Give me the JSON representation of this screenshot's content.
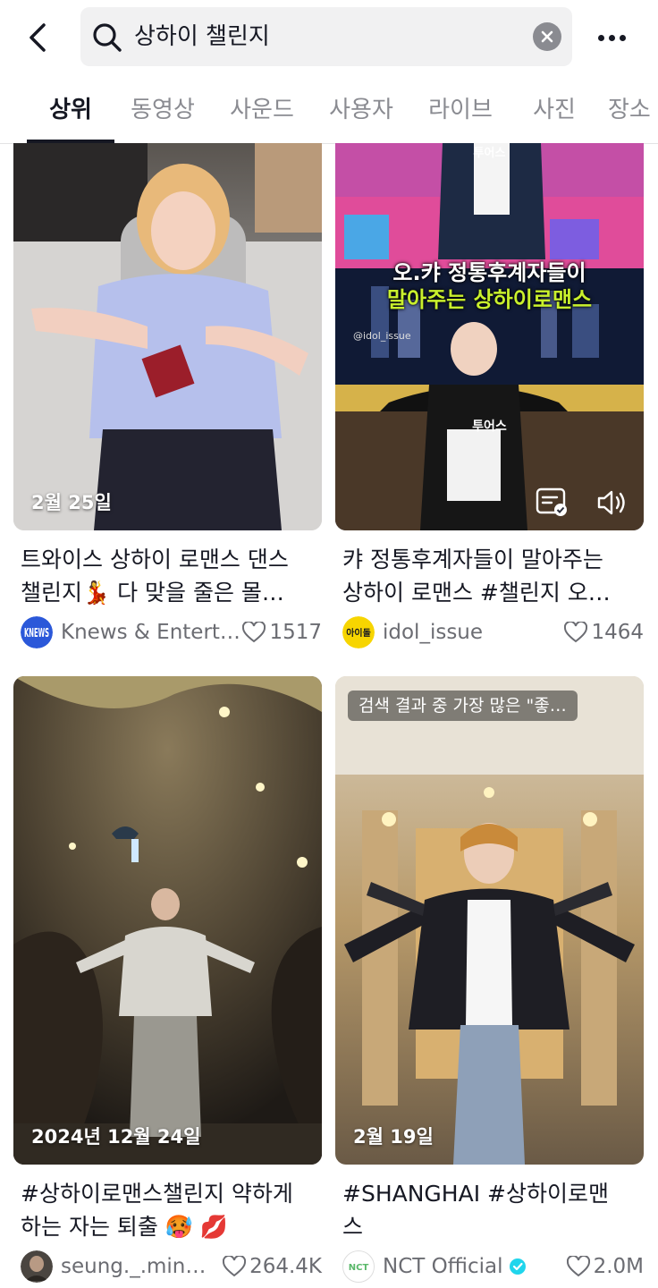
{
  "search": {
    "query": "상하이 챌린지"
  },
  "tabs": [
    "상위",
    "동영상",
    "사운드",
    "사용자",
    "라이브",
    "사진",
    "장소"
  ],
  "videos": [
    {
      "date": "2월 25일",
      "title_line1": "트와이스 상하이 로맨스 댄스",
      "title_line2": "챌린지💃 다 맞을 줄은 몰…",
      "author": "Knews & Entert…",
      "likes": "1517",
      "avatar_text": "KNEWS"
    },
    {
      "date": "",
      "title_line1": "캬 정통후계자들이 말아주는",
      "title_line2": "상하이 로맨스 #챌린지 오…",
      "author": "idol_issue",
      "likes": "1464",
      "avatar_text": "아이돌",
      "overlay_line1": "오.캬 정통후계자들이",
      "overlay_line2": "말아주는 상하이로맨스",
      "watermark": "@idol_issue",
      "name_top": "투어스",
      "name_mid": "투어스"
    },
    {
      "date": "2024년 12월 24일",
      "title_line1": "#상하이로맨스챌린지 약하게",
      "title_line2": "하는 자는 퇴출 🥵 💋",
      "author": "seung._.min…",
      "likes": "264.4K"
    },
    {
      "date": "2월 19일",
      "title_line1": "#SHANGHAI #상하이로맨",
      "title_line2": "스",
      "author": "NCT Official",
      "likes": "2.0M",
      "label": "검색 결과 중 가장 많은 \"좋…",
      "avatar_text": "NCT"
    }
  ],
  "colors": {
    "accent_yellow": "#f7d500",
    "knews_blue": "#2b58d9",
    "verified": "#20d5ec"
  }
}
